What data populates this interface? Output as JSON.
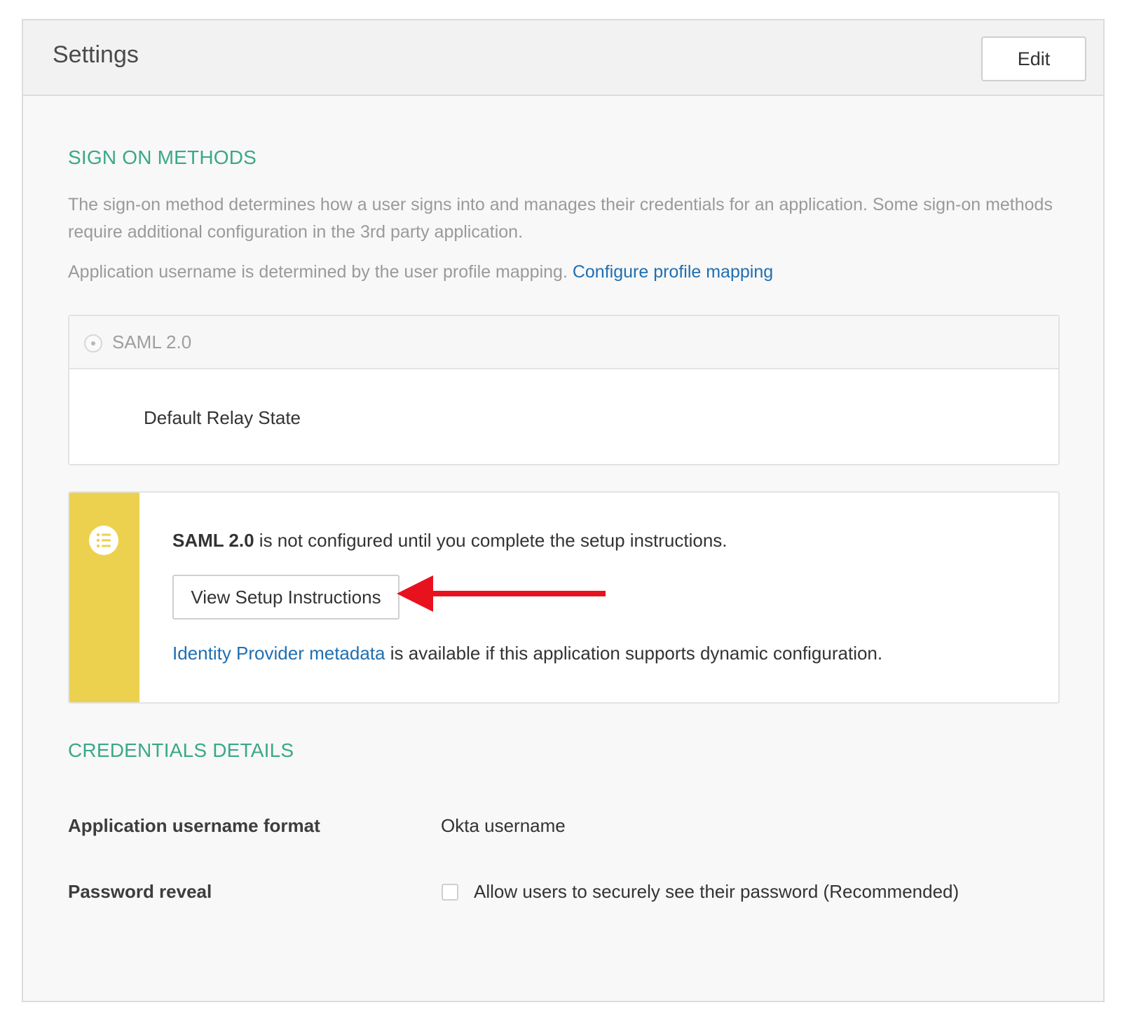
{
  "panel": {
    "title": "Settings",
    "edit_label": "Edit"
  },
  "sign_on": {
    "heading": "SIGN ON METHODS",
    "description": "The sign-on method determines how a user signs into and manages their credentials for an application. Some sign-on methods require additional configuration in the 3rd party application.",
    "username_note": "Application username is determined by the user profile mapping.",
    "configure_link": "Configure profile mapping",
    "method_label": "SAML 2.0",
    "relay_state_label": "Default Relay State"
  },
  "notice": {
    "method_bold": "SAML 2.0",
    "message": "is not configured until you complete the setup instructions.",
    "button_label": "View Setup Instructions",
    "metadata_link": "Identity Provider metadata",
    "metadata_text": "is available if this application supports dynamic configuration.",
    "stripe_color": "#ecd14f",
    "icon": "list-icon"
  },
  "credentials": {
    "heading": "CREDENTIALS DETAILS",
    "username_format_label": "Application username format",
    "username_format_value": "Okta username",
    "password_reveal_label": "Password reveal",
    "password_reveal_option": "Allow users to securely see their password (Recommended)",
    "password_reveal_checked": false
  },
  "annotation": {
    "arrow_color": "#e8121f"
  },
  "colors": {
    "heading_accent": "#3aa888",
    "link": "#1f6fb2"
  }
}
